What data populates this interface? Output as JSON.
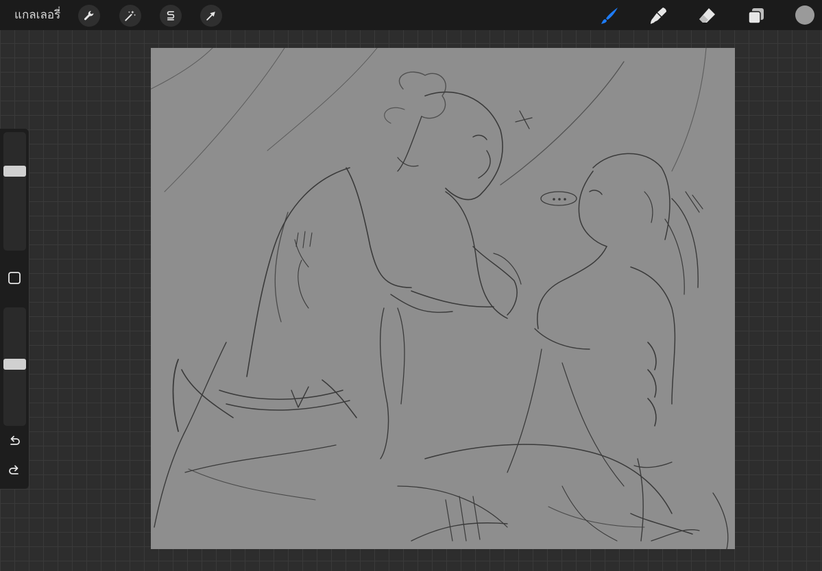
{
  "topbar": {
    "gallery_label": "แกลเลอรี่",
    "tools_left": [
      {
        "name": "actions",
        "icon": "wrench-icon"
      },
      {
        "name": "adjustments",
        "icon": "magic-wand-icon"
      },
      {
        "name": "selection",
        "icon": "selection-s-icon"
      },
      {
        "name": "transform",
        "icon": "arrow-cursor-icon"
      }
    ],
    "tools_right": [
      {
        "name": "brush",
        "icon": "brush-icon",
        "active": true
      },
      {
        "name": "smudge",
        "icon": "smudge-icon",
        "active": false
      },
      {
        "name": "eraser",
        "icon": "eraser-icon",
        "active": false
      },
      {
        "name": "layers",
        "icon": "layers-icon",
        "active": false
      }
    ],
    "current_color": "#9a9a9a"
  },
  "sidebar": {
    "brush_size_level": 0.31,
    "opacity_level": 0.48,
    "modify_icon": "square-outline-icon",
    "undo_icon": "undo-icon",
    "redo_icon": "redo-icon"
  },
  "colors": {
    "toolbar_bg": "#1b1b1b",
    "active_tool": "#1e7bf5",
    "inactive_tool": "#e6e6e6",
    "canvas_bg": "#8e8e8e",
    "sketch_stroke": "#3a3a3a"
  }
}
